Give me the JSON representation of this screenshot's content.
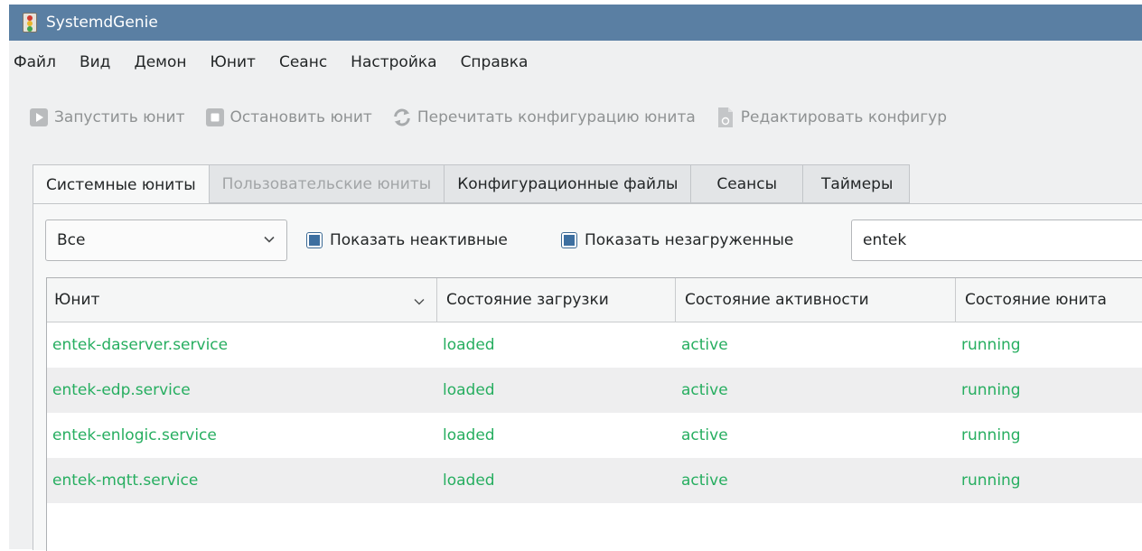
{
  "window": {
    "title": "SystemdGenie"
  },
  "menu": [
    "Файл",
    "Вид",
    "Демон",
    "Юнит",
    "Сеанс",
    "Настройка",
    "Справка"
  ],
  "toolbar": {
    "start_label": "Запустить юнит",
    "stop_label": "Остановить юнит",
    "reload_label": "Перечитать конфигурацию юнита",
    "edit_label": "Редактировать конфигур"
  },
  "tabs": [
    "Системные юниты",
    "Пользовательские юниты",
    "Конфигурационные файлы",
    "Сеансы",
    "Таймеры"
  ],
  "filters": {
    "unit_type": "Все",
    "show_inactive_label": "Показать неактивные",
    "show_inactive_checked": true,
    "show_unloaded_label": "Показать незагруженные",
    "show_unloaded_checked": true,
    "search_value": "entek"
  },
  "table": {
    "columns": [
      "Юнит",
      "Состояние загрузки",
      "Состояние активности",
      "Состояние юнита"
    ],
    "rows": [
      {
        "unit": "entek-daserver.service",
        "load": "loaded",
        "active": "active",
        "sub": "running"
      },
      {
        "unit": "entek-edp.service",
        "load": "loaded",
        "active": "active",
        "sub": "running"
      },
      {
        "unit": "entek-enlogic.service",
        "load": "loaded",
        "active": "active",
        "sub": "running"
      },
      {
        "unit": "entek-mqtt.service",
        "load": "loaded",
        "active": "active",
        "sub": "running"
      }
    ]
  },
  "colors": {
    "titlebar": "#5a7fa3",
    "active_unit_text": "#27ae60",
    "checkbox_fill": "#3d6fa0"
  }
}
